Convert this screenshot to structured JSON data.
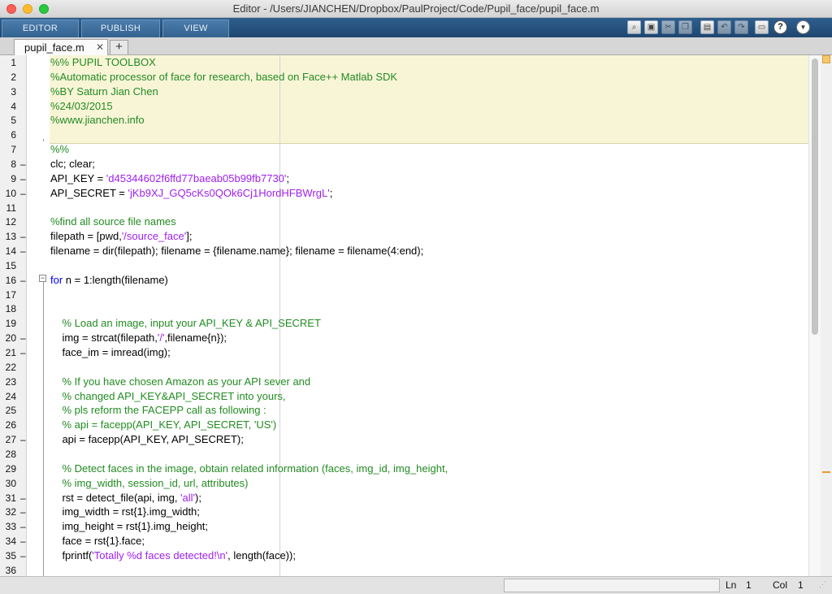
{
  "window": {
    "title": "Editor - /Users/JIANCHEN/Dropbox/PaulProject/Code/Pupil_face/pupil_face.m"
  },
  "ribbon": {
    "tabs": [
      "EDITOR",
      "PUBLISH",
      "VIEW"
    ]
  },
  "file_tab": {
    "name": "pupil_face.m",
    "close": "✕",
    "add": "+"
  },
  "toolbar": {
    "icons": [
      "find-files-icon",
      "save-icon",
      "cut-icon",
      "copy-icon",
      "paste-icon",
      "undo-icon",
      "redo-icon",
      "print-icon",
      "help-icon",
      "dropdown-icon"
    ],
    "help_glyph": "?",
    "dropdown_glyph": "▼"
  },
  "code": [
    [
      {
        "t": "c",
        "v": "%% PUPIL TOOLBOX"
      }
    ],
    [
      {
        "t": "c",
        "v": "%Automatic processor of face for research, based on Face++ Matlab SDK"
      }
    ],
    [
      {
        "t": "c",
        "v": "%BY Saturn Jian Chen"
      }
    ],
    [
      {
        "t": "c",
        "v": "%24/03/2015"
      }
    ],
    [
      {
        "t": "c",
        "v": "%www.jianchen.info"
      }
    ],
    [],
    [
      {
        "t": "c",
        "v": "%%"
      }
    ],
    [
      {
        "t": "p",
        "v": "clc; clear;"
      }
    ],
    [
      {
        "t": "p",
        "v": "API_KEY = "
      },
      {
        "t": "s",
        "v": "'d45344602f6ffd77baeab05b99fb7730'"
      },
      {
        "t": "p",
        "v": ";"
      }
    ],
    [
      {
        "t": "p",
        "v": "API_SECRET = "
      },
      {
        "t": "s",
        "v": "'jKb9XJ_GQ5cKs0QOk6Cj1HordHFBWrgL'"
      },
      {
        "t": "p",
        "v": ";"
      }
    ],
    [],
    [
      {
        "t": "c",
        "v": "%find all source file names"
      }
    ],
    [
      {
        "t": "p",
        "v": "filepath = [pwd,"
      },
      {
        "t": "s",
        "v": "'/source_face'"
      },
      {
        "t": "p",
        "v": "];"
      }
    ],
    [
      {
        "t": "p",
        "v": "filename = dir(filepath); filename = {filename.name}; filename = filename(4:end);"
      }
    ],
    [],
    [
      {
        "t": "k",
        "v": "for"
      },
      {
        "t": "p",
        "v": " n = 1:length(filename)"
      }
    ],
    [],
    [],
    [
      {
        "t": "p",
        "v": "    "
      },
      {
        "t": "c",
        "v": "% Load an image, input your API_KEY & API_SECRET"
      }
    ],
    [
      {
        "t": "p",
        "v": "    img = strcat(filepath,"
      },
      {
        "t": "s",
        "v": "'/'"
      },
      {
        "t": "p",
        "v": ",filename{n});"
      }
    ],
    [
      {
        "t": "p",
        "v": "    face_im = imread(img);"
      }
    ],
    [],
    [
      {
        "t": "p",
        "v": "    "
      },
      {
        "t": "c",
        "v": "% If you have chosen Amazon as your API sever and"
      }
    ],
    [
      {
        "t": "p",
        "v": "    "
      },
      {
        "t": "c",
        "v": "% changed API_KEY&API_SECRET into yours,"
      }
    ],
    [
      {
        "t": "p",
        "v": "    "
      },
      {
        "t": "c",
        "v": "% pls reform the FACEPP call as following :"
      }
    ],
    [
      {
        "t": "p",
        "v": "    "
      },
      {
        "t": "c",
        "v": "% api = facepp(API_KEY, API_SECRET, 'US')"
      }
    ],
    [
      {
        "t": "p",
        "v": "    api = facepp(API_KEY, API_SECRET);"
      }
    ],
    [],
    [
      {
        "t": "p",
        "v": "    "
      },
      {
        "t": "c",
        "v": "% Detect faces in the image, obtain related information (faces, img_id, img_height,"
      }
    ],
    [
      {
        "t": "p",
        "v": "    "
      },
      {
        "t": "c",
        "v": "% img_width, session_id, url, attributes)"
      }
    ],
    [
      {
        "t": "p",
        "v": "    rst = detect_file(api, img, "
      },
      {
        "t": "s",
        "v": "'all'"
      },
      {
        "t": "p",
        "v": ");"
      }
    ],
    [
      {
        "t": "p",
        "v": "    img_width = rst{1}.img_width;"
      }
    ],
    [
      {
        "t": "p",
        "v": "    img_height = rst{1}.img_height;"
      }
    ],
    [
      {
        "t": "p",
        "v": "    face = rst{1}.face;"
      }
    ],
    [
      {
        "t": "p",
        "v": "    fprintf("
      },
      {
        "t": "s",
        "v": "'Totally %d faces detected!\\n'"
      },
      {
        "t": "p",
        "v": ", length(face));"
      }
    ],
    []
  ],
  "executable_lines": [
    8,
    9,
    10,
    13,
    14,
    16,
    20,
    21,
    27,
    31,
    32,
    33,
    34,
    35
  ],
  "status": {
    "ln_label": "Ln",
    "ln_value": "1",
    "col_label": "Col",
    "col_value": "1"
  },
  "colors": {
    "comment": "#228b22",
    "string": "#a020f0",
    "keyword": "#0000ff",
    "cell_highlight": "#f8f5d7",
    "ribbon": "#2f5f8e"
  }
}
